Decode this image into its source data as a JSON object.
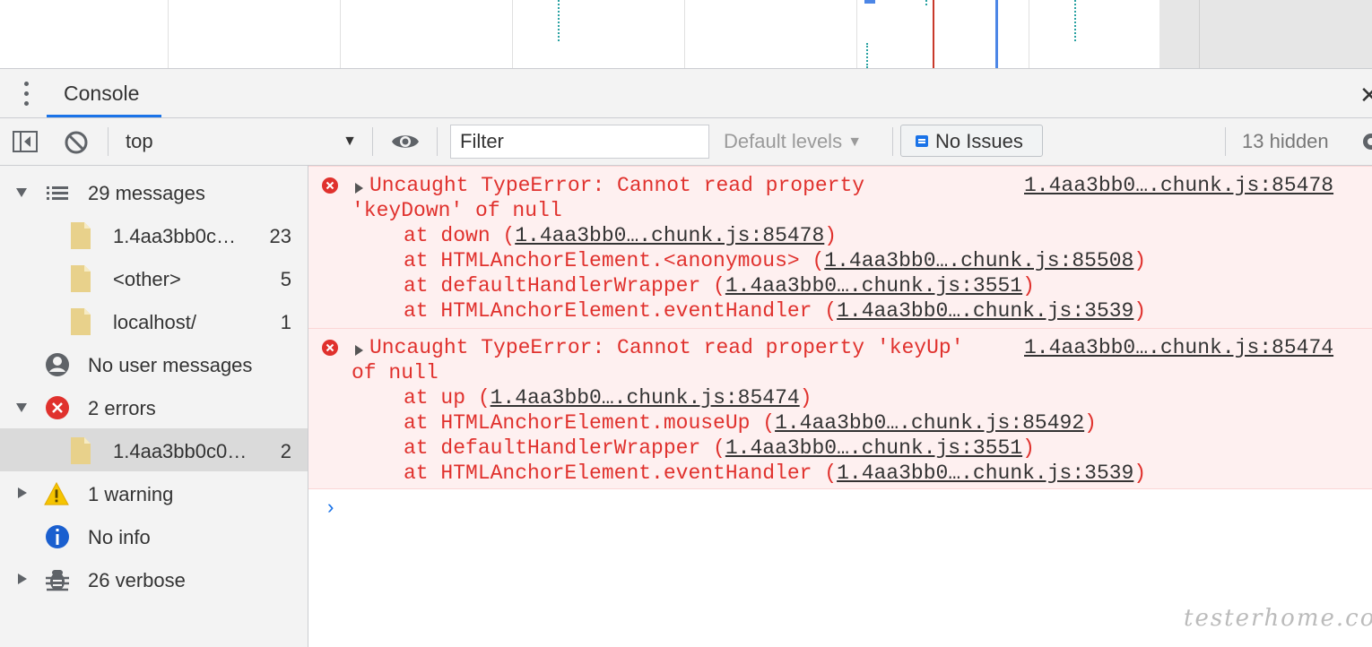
{
  "drawer": {
    "tab_label": "Console"
  },
  "toolbar": {
    "context_value": "top",
    "filter_placeholder": "Filter",
    "levels_label": "Default levels",
    "issues_label": "No Issues",
    "hidden_label": "13 hidden"
  },
  "sidebar": {
    "messages": {
      "label": "29 messages"
    },
    "message_files": [
      {
        "label": "1.4aa3bb0c…",
        "count": "23"
      },
      {
        "label": "<other>",
        "count": "5"
      },
      {
        "label": "localhost/",
        "count": "1"
      }
    ],
    "user_messages": {
      "label": "No user messages"
    },
    "errors": {
      "label": "2 errors"
    },
    "error_files": [
      {
        "label": "1.4aa3bb0c0…",
        "count": "2"
      }
    ],
    "warnings": {
      "label": "1 warning"
    },
    "info": {
      "label": "No info"
    },
    "verbose": {
      "label": "26 verbose"
    }
  },
  "console": {
    "messages": [
      {
        "text_line1": "Uncaught TypeError: Cannot read property",
        "text_line2": "'keyDown' of null",
        "source": "1.4aa3bb0….chunk.js:85478",
        "stack": [
          {
            "prefix": "at down (",
            "link": "1.4aa3bb0….chunk.js:85478",
            "suffix": ")"
          },
          {
            "prefix": "at HTMLAnchorElement.<anonymous> (",
            "link": "1.4aa3bb0….chunk.js:85508",
            "suffix": ")"
          },
          {
            "prefix": "at defaultHandlerWrapper (",
            "link": "1.4aa3bb0….chunk.js:3551",
            "suffix": ")"
          },
          {
            "prefix": "at HTMLAnchorElement.eventHandler (",
            "link": "1.4aa3bb0….chunk.js:3539",
            "suffix": ")"
          }
        ]
      },
      {
        "text_line1": "Uncaught TypeError: Cannot read property 'keyUp'",
        "text_line2": "of null",
        "source": "1.4aa3bb0….chunk.js:85474",
        "stack": [
          {
            "prefix": "at up (",
            "link": "1.4aa3bb0….chunk.js:85474",
            "suffix": ")"
          },
          {
            "prefix": "at HTMLAnchorElement.mouseUp (",
            "link": "1.4aa3bb0….chunk.js:85492",
            "suffix": ")"
          },
          {
            "prefix": "at defaultHandlerWrapper (",
            "link": "1.4aa3bb0….chunk.js:3551",
            "suffix": ")"
          },
          {
            "prefix": "at HTMLAnchorElement.eventHandler (",
            "link": "1.4aa3bb0….chunk.js:3539",
            "suffix": ")"
          }
        ]
      }
    ],
    "prompt_symbol": "›"
  },
  "watermark": "testerhome.com"
}
